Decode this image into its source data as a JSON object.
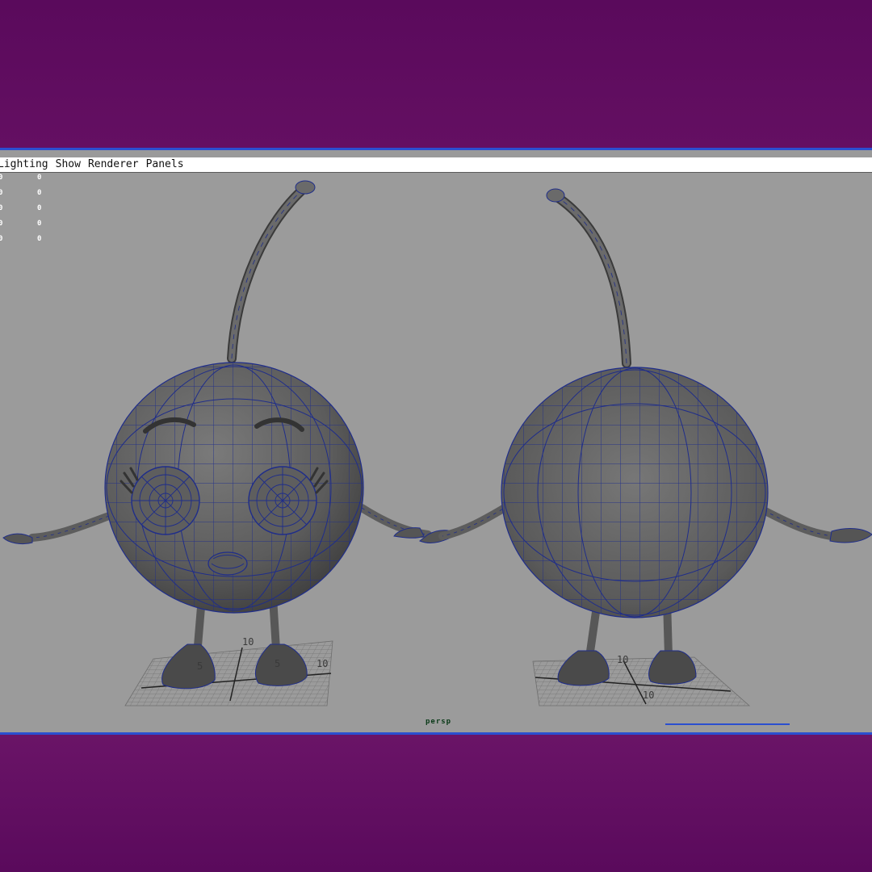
{
  "menu": {
    "items": [
      "Lighting",
      "Show",
      "Renderer",
      "Panels"
    ]
  },
  "hud": {
    "rows": [
      {
        "a": "0",
        "b": "0"
      },
      {
        "a": "0",
        "b": "0"
      },
      {
        "a": "0",
        "b": "0"
      },
      {
        "a": "0",
        "b": "0"
      },
      {
        "a": "0",
        "b": "0"
      }
    ]
  },
  "viewport": {
    "camera": "persp",
    "grid_labels_left": [
      "10",
      "5",
      "5",
      "10"
    ],
    "grid_labels_right": [
      "10",
      "10"
    ]
  },
  "colors": {
    "background": "#5c0a5f",
    "accent": "#2b4fcf",
    "viewport": "#9b9b9b",
    "mesh": "#616161",
    "wire": "#1f2d8a"
  }
}
